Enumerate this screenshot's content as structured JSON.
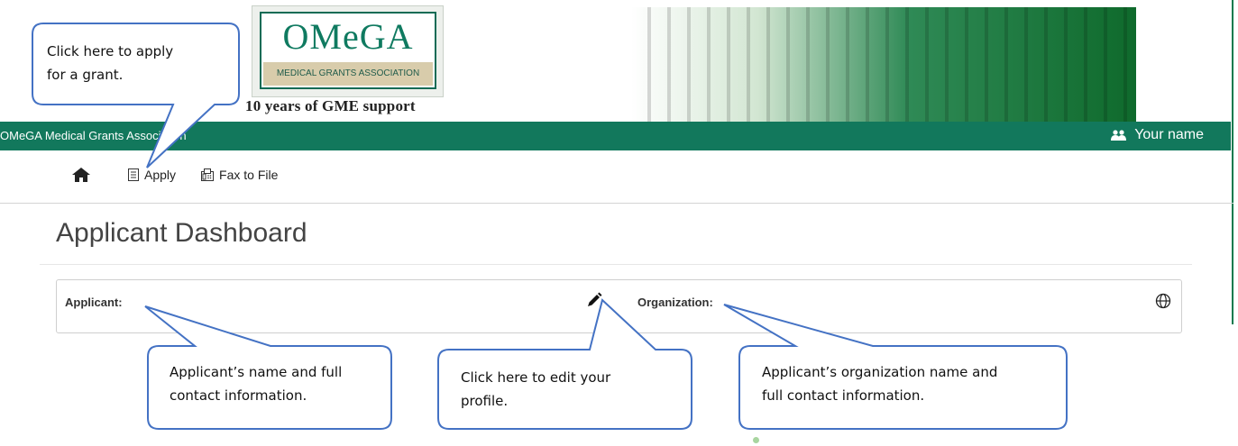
{
  "logo": {
    "wordmark": "OMeGA",
    "subtitle": "MEDICAL GRANTS ASSOCIATION",
    "tagline": "10 years of GME support"
  },
  "navbar": {
    "site_name": "OMeGA Medical Grants Association",
    "user_label": "Your name",
    "user_icon": "users-icon",
    "color": "#12785c"
  },
  "toolbar": {
    "home_icon": "home-icon",
    "apply_label": "Apply",
    "fax_label": "Fax to File"
  },
  "page": {
    "title": "Applicant Dashboard"
  },
  "panel": {
    "applicant_label": "Applicant:",
    "organization_label": "Organization:",
    "edit_icon": "pencil-icon",
    "globe_icon": "globe-icon"
  },
  "callouts": {
    "apply": "Click here to apply for a grant.",
    "apply_line1": "Click here to apply",
    "apply_line2": "for a grant.",
    "applicant_line1": "Applicant’s name and full",
    "applicant_line2": "contact information.",
    "edit_line1": "Click here to edit your",
    "edit_line2": "profile.",
    "org_line1": "Applicant’s organization name and",
    "org_line2": "full contact information.",
    "border_color": "#4472c4"
  }
}
